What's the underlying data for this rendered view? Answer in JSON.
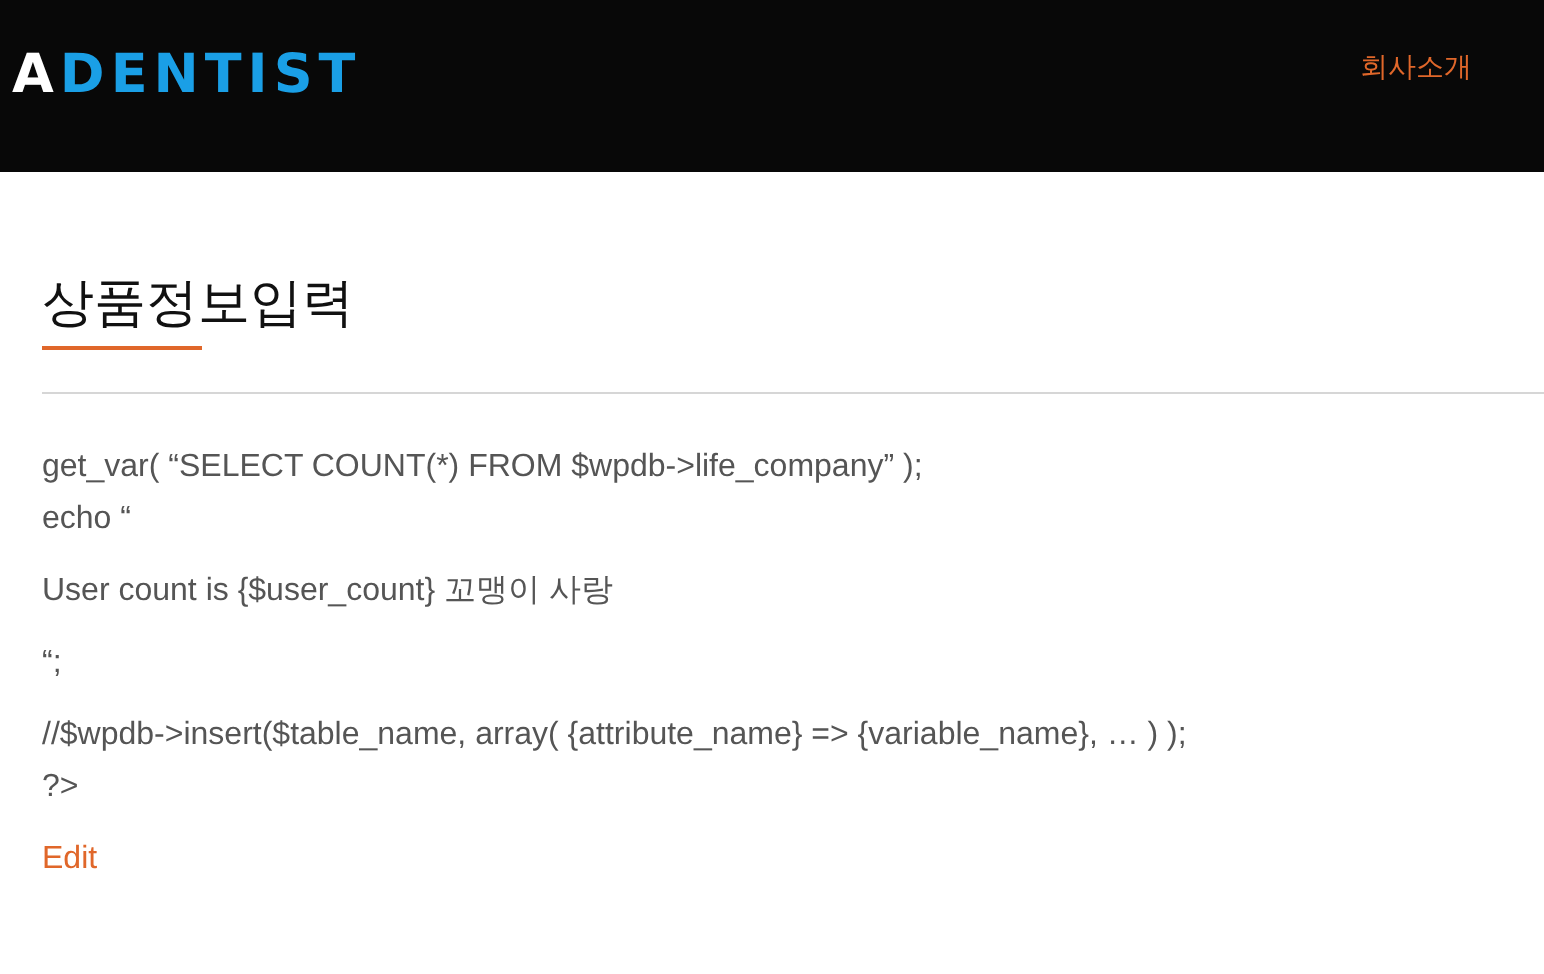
{
  "header": {
    "logo": "**A**DENTIST",
    "nav": [
      "회사소개"
    ]
  },
  "page": {
    "title": "상품정보입력",
    "paragraphs": [
      [
        "get_var( “SELECT COUNT(*) FROM $wpdb->life_company” );",
        "echo “"
      ],
      [
        "User count is {$user_count} 꼬맹이 사랑"
      ],
      [
        "“;"
      ],
      [
        "//$wpdb->insert($table_name, array( {attribute_name} => {variable_name}, … ) );",
        "?>"
      ]
    ],
    "edit_link": "Edit"
  }
}
